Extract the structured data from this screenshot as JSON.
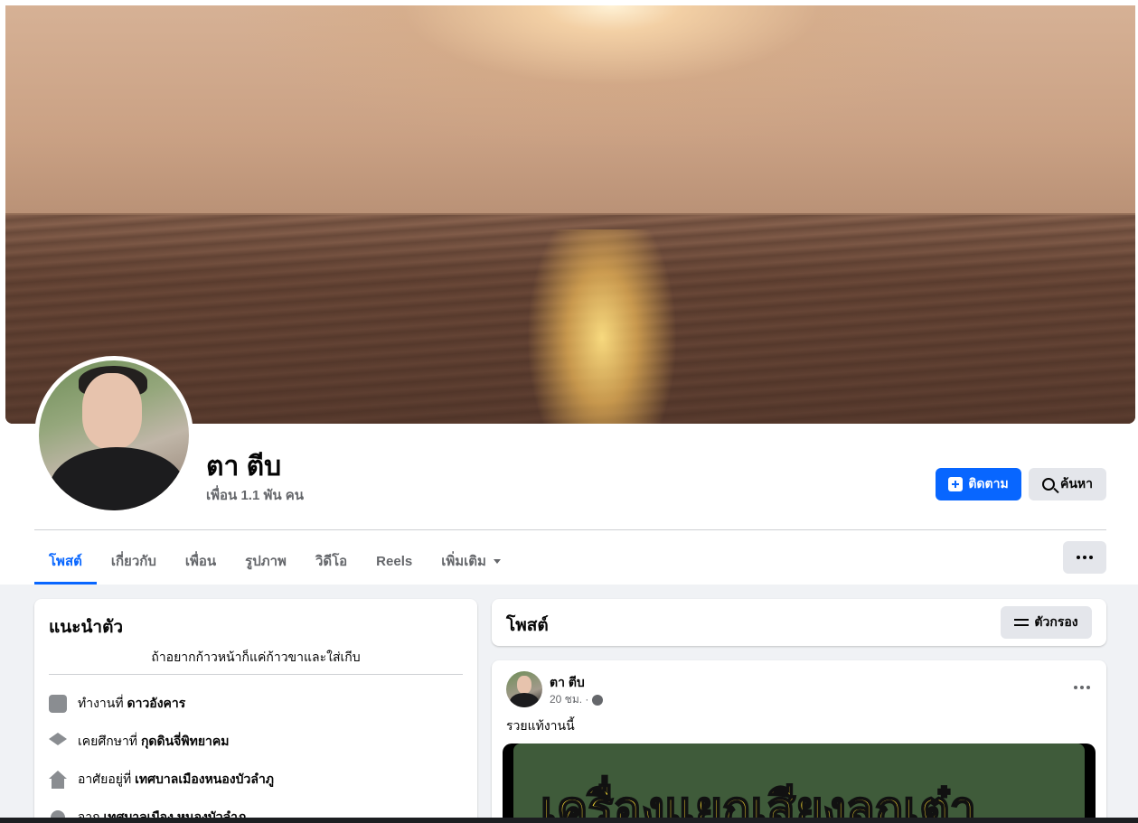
{
  "profile": {
    "name": "ตา ตีบ",
    "friends": "เพื่อน 1.1 พัน คน"
  },
  "actions": {
    "follow_label": "ติดตาม",
    "search_label": "ค้นหา"
  },
  "tabs": [
    {
      "label": "โพสต์",
      "active": true
    },
    {
      "label": "เกี่ยวกับ"
    },
    {
      "label": "เพื่อน"
    },
    {
      "label": "รูปภาพ"
    },
    {
      "label": "วิดีโอ"
    },
    {
      "label": "Reels"
    },
    {
      "label": "เพิ่มเติม"
    }
  ],
  "intro": {
    "title": "แนะนำตัว",
    "bio": "ถ้าอยากก้าวหน้าก็แค่ก้าวขาและใส่เกีบ",
    "items": [
      {
        "icon": "briefcase-icon",
        "prefix": "ทำงานที่",
        "value": "ดาวอังคาร"
      },
      {
        "icon": "graduation-cap-icon",
        "prefix": "เคยศึกษาที่",
        "value": "กุดดินจี่พิทยาคม"
      },
      {
        "icon": "home-icon",
        "prefix": "อาศัยอยู่ที่",
        "value": "เทศบาลเมืองหนองบัวลำภู"
      },
      {
        "icon": "location-pin-icon",
        "prefix": "จาก",
        "value": "เทศบาลเมือง หนองบัวลำภู"
      }
    ]
  },
  "posts_section": {
    "title": "โพสต์",
    "filter_label": "ตัวกรอง"
  },
  "post": {
    "author": "ตา ตีบ",
    "time": "20 ชม. ·",
    "text": "รวยแท้งานนี้",
    "image_headline": "เครื่องแยกเสียงลูกเต๋า"
  },
  "colors": {
    "accent": "#0866ff",
    "page_bg": "#f0f2f5",
    "secondary_button": "#e4e6eb"
  }
}
